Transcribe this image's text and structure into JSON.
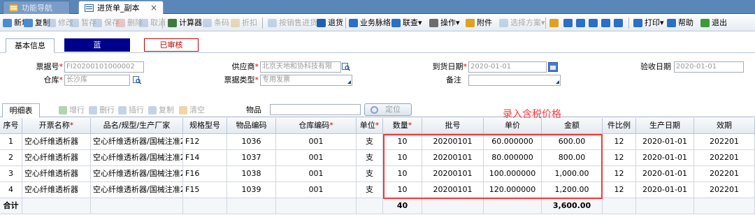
{
  "tabs": [
    {
      "label": "功能导航",
      "active": false
    },
    {
      "label": "进货单_副本",
      "active": true,
      "close": "×"
    }
  ],
  "toolbar": [
    {
      "label": "新增",
      "icon": "new-doc-icon",
      "color": "#4a8bd6",
      "enabled": true
    },
    {
      "label": "复制",
      "icon": "copy-icon",
      "color": "#4a8bd6",
      "enabled": true
    },
    {
      "label": "修改",
      "icon": "edit-icon",
      "color": "#8aa9cf",
      "enabled": false
    },
    {
      "label": "暂存",
      "icon": "draft-icon",
      "color": "#8aa9cf",
      "enabled": false
    },
    {
      "label": "保存",
      "icon": "save-icon",
      "color": "#8aa9cf",
      "enabled": false
    },
    {
      "label": "删除",
      "icon": "delete-icon",
      "color": "#d98c8c",
      "enabled": false
    },
    {
      "label": "取消",
      "icon": "cancel-icon",
      "color": "#8aa9cf",
      "enabled": false
    },
    {
      "label": "计算器",
      "icon": "calculator-icon",
      "color": "#3c7a3c",
      "enabled": true
    },
    {
      "label": "条码",
      "icon": "barcode-icon",
      "color": "#8aa9cf",
      "enabled": false
    },
    {
      "label": "折扣",
      "icon": "discount-icon",
      "color": "#d9b36b",
      "enabled": false
    },
    {
      "label": "按销售进货",
      "icon": "sales-purchase-icon",
      "color": "#8aa9cf",
      "enabled": false
    },
    {
      "label": "退货",
      "icon": "return-icon",
      "color": "#1f5fb0",
      "enabled": true
    },
    {
      "label": "业务脉络",
      "icon": "business-flow-icon",
      "color": "#2a6fc9",
      "enabled": true
    },
    {
      "label": "联查▾",
      "icon": "linked-query-icon",
      "color": "#2a6fc9",
      "enabled": true
    },
    {
      "label": "操作▾",
      "icon": "operation-icon",
      "color": "#6c6c6c",
      "enabled": true
    },
    {
      "label": "附件",
      "icon": "attachment-icon",
      "color": "#e0a020",
      "enabled": true
    },
    {
      "label": "选择方案▾",
      "icon": "scheme-icon",
      "color": "#8aa9cf",
      "enabled": false
    },
    {
      "label": "",
      "icon": "filter-icon",
      "color": "#e0a020",
      "enabled": true
    },
    {
      "label": "",
      "icon": "first-record-icon",
      "color": "#2a6fc9",
      "enabled": true
    },
    {
      "label": "",
      "icon": "prev-record-icon",
      "color": "#2a6fc9",
      "enabled": true
    },
    {
      "label": "",
      "icon": "next-record-icon",
      "color": "#2a6fc9",
      "enabled": true
    },
    {
      "label": "",
      "icon": "last-record-icon",
      "color": "#2a6fc9",
      "enabled": true
    },
    {
      "label": "",
      "icon": "window-icon",
      "color": "#2a6fc9",
      "enabled": true
    },
    {
      "label": "打印▾",
      "icon": "print-icon",
      "color": "#2a6fc9",
      "enabled": true
    },
    {
      "label": "帮助",
      "icon": "help-icon",
      "color": "#2a6fc9",
      "enabled": true
    },
    {
      "label": "退出",
      "icon": "exit-icon",
      "color": "#3c9a3c",
      "enabled": true
    }
  ],
  "subtabs": {
    "basic": "基本信息",
    "color_label": "蓝",
    "status": "已审核"
  },
  "colors": {
    "navy": "#00008b",
    "status_red": "#c00000",
    "annotation_red": "#ff3333"
  },
  "form": {
    "bill_no": {
      "label": "票据号",
      "value": "FI20200101000002"
    },
    "supplier": {
      "label": "供应商",
      "value": "北京天地和协科技有限"
    },
    "arrival_date": {
      "label": "到货日期",
      "value": "2020-01-01"
    },
    "check_date": {
      "label": "验收日期",
      "value": "2020-01-01"
    },
    "warehouse": {
      "label": "仓库",
      "value": "长沙库"
    },
    "bill_type": {
      "label": "票据类型",
      "value": "专用发票"
    },
    "remark": {
      "label": "备注",
      "value": ""
    }
  },
  "detail": {
    "tab": "明细表",
    "buttons": [
      "增行",
      "删行",
      "插行",
      "复制",
      "清空"
    ],
    "item_label": "物品",
    "item_value": "",
    "locate": "定位"
  },
  "annotation": "录入含税价格",
  "grid": {
    "columns": [
      "序号",
      "开票名称",
      "品名/规型/生产厂家",
      "规格型号",
      "物品编码",
      "仓库编码",
      "单位",
      "数量",
      "批号",
      "单价",
      "金额",
      "件比例",
      "生产日期",
      "效期"
    ],
    "required": [
      false,
      true,
      false,
      false,
      false,
      true,
      true,
      true,
      false,
      false,
      false,
      false,
      false,
      false
    ],
    "rows": [
      [
        "1",
        "空心纤维透析器",
        "空心纤维透析器/国械注准2...",
        "F12",
        "1036",
        "001",
        "支",
        "10",
        "20200101",
        "60.000000",
        "600.00",
        "12",
        "2020-01-01",
        "202201"
      ],
      [
        "2",
        "空心纤维透析器",
        "空心纤维透析器/国械注准2...",
        "F14",
        "1037",
        "001",
        "支",
        "10",
        "20200101",
        "80.000000",
        "800.00",
        "12",
        "2020-01-01",
        "202201"
      ],
      [
        "3",
        "空心纤维透析器",
        "空心纤维透析器/国械注准2...",
        "F16",
        "1038",
        "001",
        "支",
        "10",
        "20200101",
        "100.000000",
        "1,000.00",
        "12",
        "2020-01-01",
        "202201"
      ],
      [
        "4",
        "空心纤维透析器",
        "空心纤维透析器/国械注准2...",
        "F15",
        "1039",
        "001",
        "支",
        "10",
        "20200101",
        "120.000000",
        "1,200.00",
        "12",
        "2020-01-01",
        "202201"
      ]
    ],
    "footer": {
      "label": "合计",
      "qty": "40",
      "amount": "3,600.00"
    }
  }
}
